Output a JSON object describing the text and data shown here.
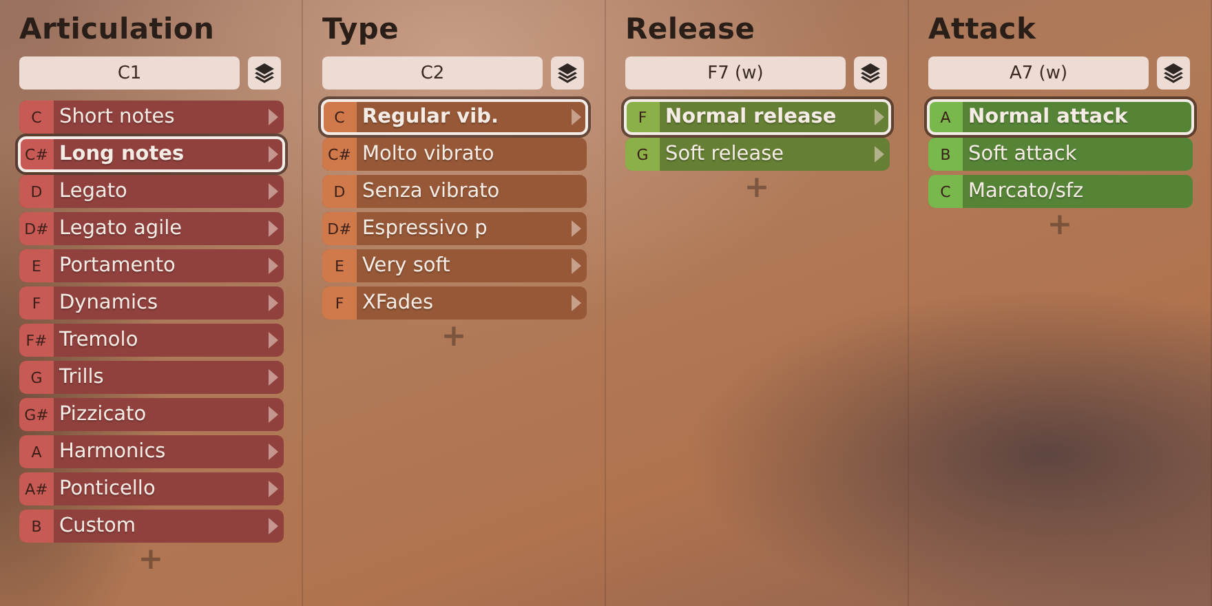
{
  "columns": [
    {
      "title": "Articulation",
      "key_field": "C1",
      "color": "#c85a55",
      "add": "+",
      "items": [
        {
          "key": "C",
          "label": "Short notes",
          "selected": false,
          "submenu": true
        },
        {
          "key": "C#",
          "label": "Long notes",
          "selected": true,
          "submenu": true
        },
        {
          "key": "D",
          "label": "Legato",
          "selected": false,
          "submenu": true
        },
        {
          "key": "D#",
          "label": "Legato agile",
          "selected": false,
          "submenu": true
        },
        {
          "key": "E",
          "label": "Portamento",
          "selected": false,
          "submenu": true
        },
        {
          "key": "F",
          "label": "Dynamics",
          "selected": false,
          "submenu": true
        },
        {
          "key": "F#",
          "label": "Tremolo",
          "selected": false,
          "submenu": true
        },
        {
          "key": "G",
          "label": "Trills",
          "selected": false,
          "submenu": true
        },
        {
          "key": "G#",
          "label": "Pizzicato",
          "selected": false,
          "submenu": true
        },
        {
          "key": "A",
          "label": "Harmonics",
          "selected": false,
          "submenu": true
        },
        {
          "key": "A#",
          "label": "Ponticello",
          "selected": false,
          "submenu": true
        },
        {
          "key": "B",
          "label": "Custom",
          "selected": false,
          "submenu": true
        }
      ]
    },
    {
      "title": "Type",
      "key_field": "C2",
      "color": "#d07a4c",
      "add": "+",
      "items": [
        {
          "key": "C",
          "label": "Regular vib.",
          "selected": true,
          "submenu": true
        },
        {
          "key": "C#",
          "label": "Molto vibrato",
          "selected": false,
          "submenu": false
        },
        {
          "key": "D",
          "label": "Senza vibrato",
          "selected": false,
          "submenu": false
        },
        {
          "key": "D#",
          "label": "Espressivo p",
          "selected": false,
          "submenu": true
        },
        {
          "key": "E",
          "label": "Very soft",
          "selected": false,
          "submenu": true
        },
        {
          "key": "F",
          "label": "XFades",
          "selected": false,
          "submenu": true
        }
      ]
    },
    {
      "title": "Release",
      "key_field": "F7 (w)",
      "color": "#8cb048",
      "add": "+",
      "items": [
        {
          "key": "F",
          "label": "Normal release",
          "selected": true,
          "submenu": true
        },
        {
          "key": "G",
          "label": "Soft release",
          "selected": false,
          "submenu": true
        }
      ]
    },
    {
      "title": "Attack",
      "key_field": "A7 (w)",
      "color": "#78b84c",
      "add": "+",
      "items": [
        {
          "key": "A",
          "label": "Normal attack",
          "selected": true,
          "submenu": false
        },
        {
          "key": "B",
          "label": "Soft attack",
          "selected": false,
          "submenu": false
        },
        {
          "key": "C",
          "label": "Marcato/sfz",
          "selected": false,
          "submenu": false
        }
      ]
    }
  ]
}
